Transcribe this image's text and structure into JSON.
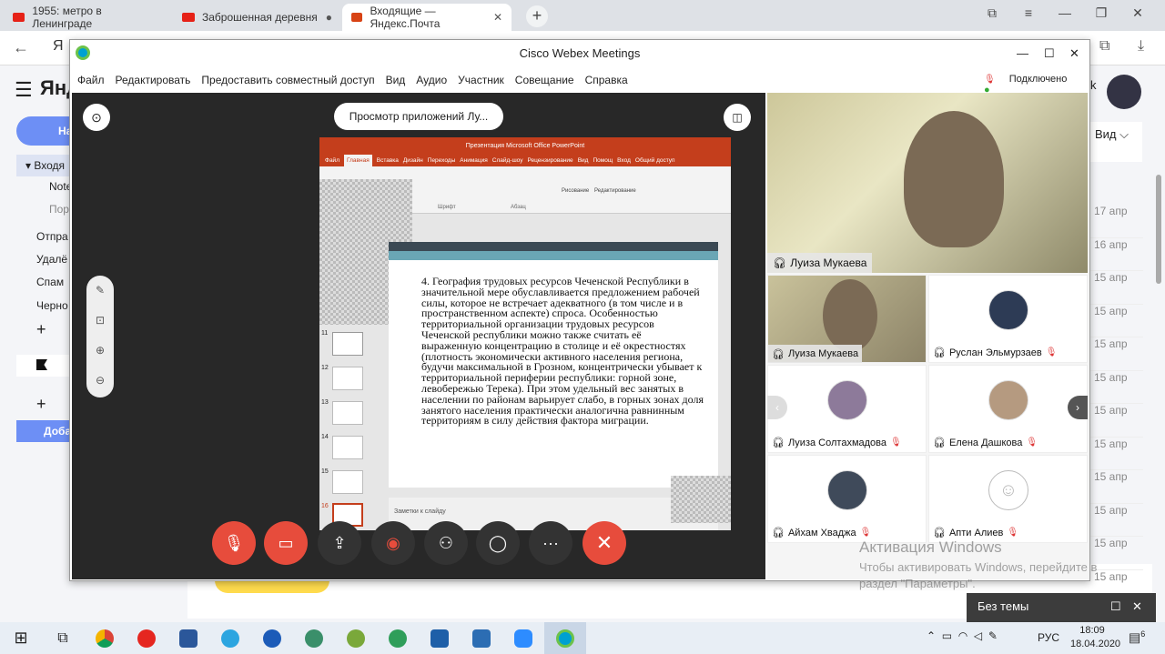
{
  "browser": {
    "tabs": [
      {
        "label": "1955: метро в Ленинграде",
        "color": "#e62117"
      },
      {
        "label": "Заброшенная деревня",
        "color": "#e62117"
      },
      {
        "label": "Входящие — Яндекс.Почта",
        "color": "#d84315"
      }
    ],
    "new_tab": "+"
  },
  "yandex": {
    "logo": "Янд",
    "compose_btn": "На",
    "inbox": "▾ Входя",
    "folders": [
      "Note",
      "Пор",
      "Отпра",
      "Удалё",
      "Спам",
      "Черно"
    ],
    "add_folder": "+",
    "add_btn": "Доба",
    "view_label": "Вид",
    "user_letter": "k",
    "dates": [
      "17 апр",
      "16 апр",
      "15 апр",
      "15 апр",
      "15 апр",
      "15 апр",
      "15 апр",
      "15 апр",
      "15 апр",
      "15 апр",
      "15 апр",
      "15 апр"
    ]
  },
  "webex": {
    "title": "Cisco Webex Meetings",
    "menu": [
      "Файл",
      "Редактировать",
      "Предоставить совместный доступ",
      "Вид",
      "Аудио",
      "Участник",
      "Совещание",
      "Справка"
    ],
    "status": "Подключено",
    "share_label": "Просмотр приложений Лу...",
    "controls": [
      "mute",
      "video",
      "share",
      "record",
      "participants",
      "chat",
      "more",
      "leave"
    ]
  },
  "ppt": {
    "title": "Презентация Microsoft Office PowerPoint",
    "ribbon_tabs": [
      "Файл",
      "Главная",
      "Вставка",
      "Дизайн",
      "Переходы",
      "Анимация",
      "Слайд-шоу",
      "Рецензирование",
      "Вид",
      "Помощ",
      "Вход",
      "Общий доступ"
    ],
    "groups": [
      "Шрифт",
      "Абзац",
      "Рисование",
      "Редактирование"
    ],
    "slide_numbers": [
      "11",
      "12",
      "13",
      "14",
      "15",
      "16"
    ],
    "slide_text": "4. География трудовых ресурсов Чеченской Республики в значительной мере обуславливается предложением рабочей силы, которое не встречает адекватного (в том числе и в пространственном аспекте) спроса. Особенностью территориальной организации трудовых ресурсов Чеченской республики можно также считать её выраженную концентрацию в столице и её окрестностях (плотность экономически активного населения региона, будучи максимальной в Грозном, концентрически убывает к территориальной периферии республики: горной зоне, левобережью Терека). При этом удельный вес занятых в населении по районам варьирует слабо, в горных зонах доля занятого населения практически аналогична равнинным территориям в силу действия фактора миграции.",
    "notes": "Заметки к слайду"
  },
  "participants": {
    "main_speaker": "Луиза Мукаева",
    "tiles": [
      {
        "name": "Луиза Мукаева",
        "muted": false
      },
      {
        "name": "Руслан Эльмурзаев",
        "muted": true
      },
      {
        "name": "Луиза Солтахмадова",
        "muted": true
      },
      {
        "name": "Елена Дашкова",
        "muted": true
      },
      {
        "name": "Айхам Хваджа",
        "muted": true
      },
      {
        "name": "Апти Алиев",
        "muted": true
      }
    ]
  },
  "watermark": {
    "title": "Активация Windows",
    "line1": "Чтобы активировать Windows, перейдите в",
    "line2": "раздел \"Параметры\"."
  },
  "popup": {
    "label": "Без темы"
  },
  "taskbar": {
    "lang": "РУС",
    "time": "18:09",
    "date": "18.04.2020",
    "notif_count": "6"
  }
}
